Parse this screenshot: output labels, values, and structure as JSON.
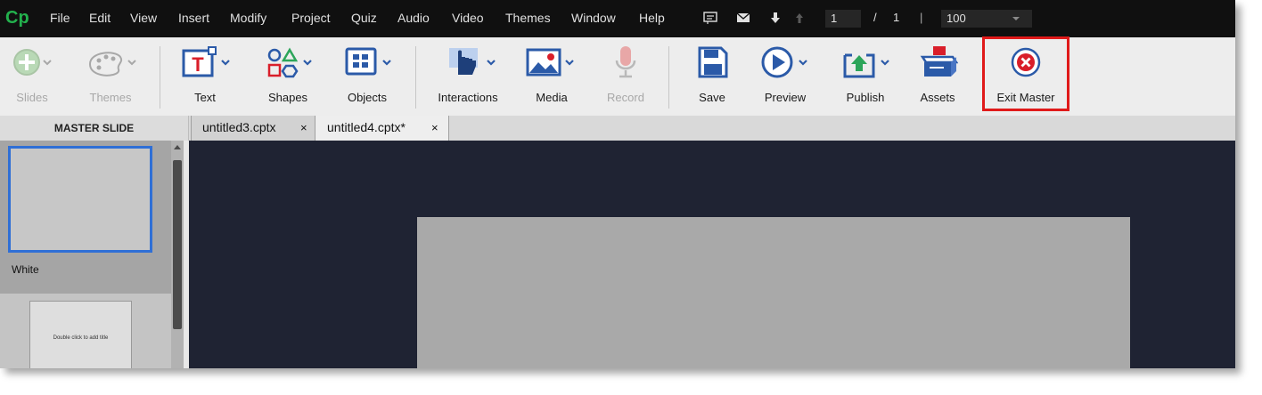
{
  "menubar": {
    "logo": "Cp",
    "items": [
      "File",
      "Edit",
      "View",
      "Insert",
      "Modify",
      "Project",
      "Quiz",
      "Audio",
      "Video",
      "Themes",
      "Window",
      "Help"
    ],
    "current_page": "1",
    "page_separator": "/",
    "total_pages": "1",
    "divider": "|",
    "zoom": "100",
    "icons": [
      "caption-icon",
      "email-icon",
      "download-arrow-icon",
      "upload-arrow-icon",
      "zoom-dropdown-icon"
    ]
  },
  "toolbar": {
    "slides": "Slides",
    "themes": "Themes",
    "text": "Text",
    "shapes": "Shapes",
    "objects": "Objects",
    "interactions": "Interactions",
    "media": "Media",
    "record": "Record",
    "save": "Save",
    "preview": "Preview",
    "publish": "Publish",
    "assets": "Assets",
    "exit_master": "Exit Master"
  },
  "colors": {
    "accent_blue": "#2b5aa8",
    "text_red": "#d91e2a",
    "logo_green": "#23b14d",
    "highlight_red": "#e01a1a",
    "selection_blue": "#2f6fd6"
  },
  "panel": {
    "header": "MASTER SLIDE",
    "master_name": "White",
    "layout_placeholder": "Double click to add title"
  },
  "tabs": [
    {
      "label": "untitled3.cptx",
      "close": "×"
    },
    {
      "label": "untitled4.cptx*",
      "close": "×"
    }
  ]
}
